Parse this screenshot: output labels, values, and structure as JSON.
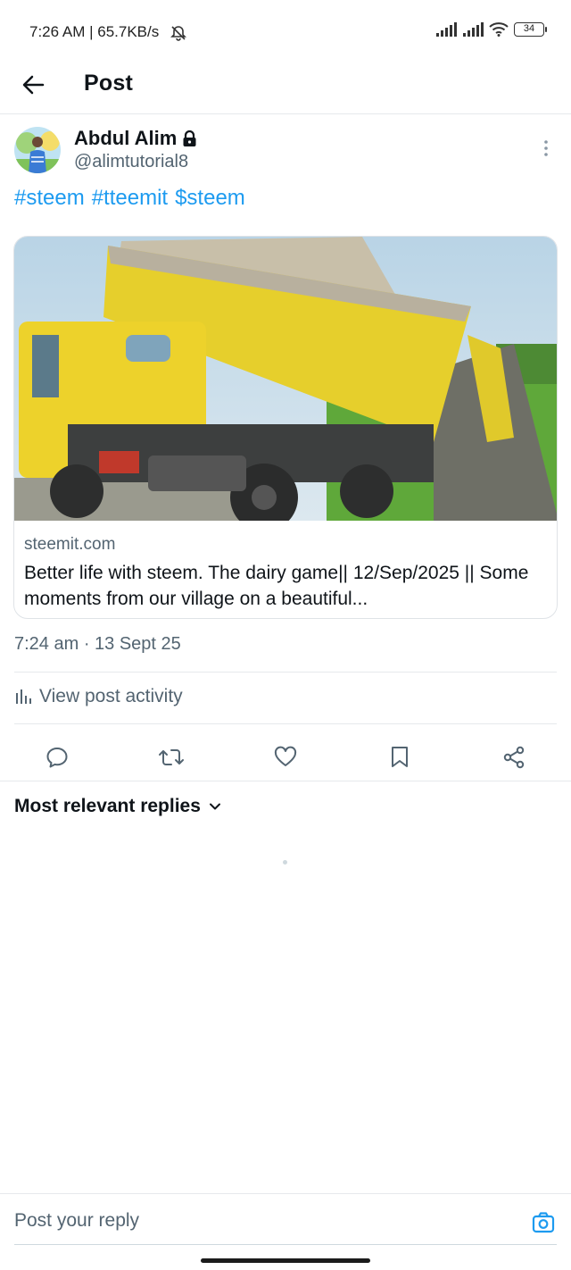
{
  "status_bar": {
    "time_speed": "7:26 AM | 65.7KB/s",
    "battery": "34",
    "icons": [
      "mute-bell-icon",
      "signal-icon",
      "signal-icon",
      "wifi-icon",
      "battery-icon"
    ]
  },
  "header": {
    "title": "Post",
    "back_icon": "arrow-left-icon"
  },
  "post": {
    "author_name": "Abdul Alim",
    "author_handle": "@alimtutorial8",
    "hashtags": [
      "#steem",
      "#tteemit",
      "$steem"
    ],
    "card": {
      "domain": "steemit.com",
      "title": "Better life with steem. The dairy game|| 12/Sep/2025 || Some moments from our village on a beautiful..."
    },
    "timestamp": "7:24 am · 13 Sept 25",
    "activity_label": "View post activity"
  },
  "actions": [
    "reply-icon",
    "repost-icon",
    "like-icon",
    "bookmark-icon",
    "share-icon"
  ],
  "replies": {
    "sort_label": "Most relevant replies"
  },
  "reply_bar": {
    "placeholder": "Post your reply"
  },
  "colors": {
    "accent": "#1d9bf0",
    "secondary_text": "#536471",
    "primary_text": "#0f1419",
    "divider": "#e6e9ec"
  }
}
